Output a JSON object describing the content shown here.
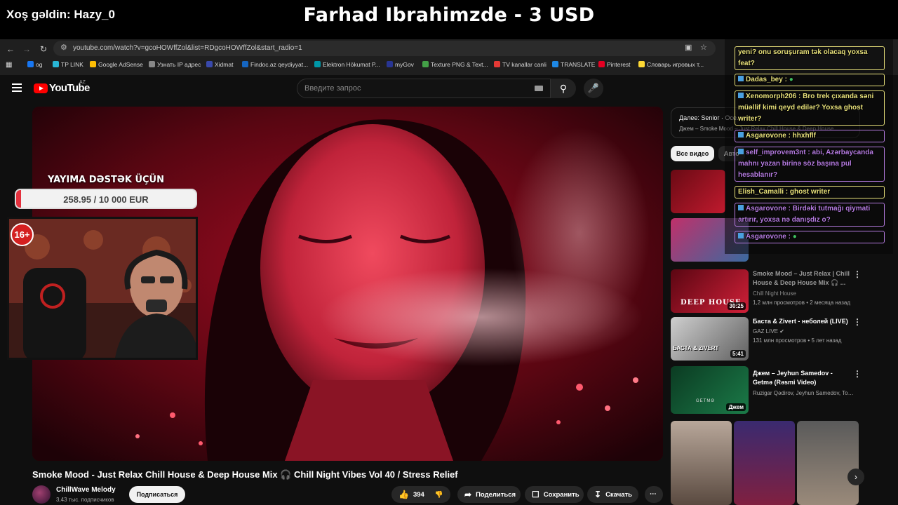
{
  "overlay": {
    "welcome": "Xoş gəldin: Hazy_0",
    "donation": "Farhad Ibrahimzde - 3 USD",
    "goal_title": "YAYIMA DƏSTƏK ÜÇÜN",
    "goal_text": "258.95 / 10 000 EUR",
    "goal_progress": 0.026,
    "age_badge": "16+",
    "chat": [
      {
        "text": "yeni? onu soruşuram tək olacaq yoxsa feat?",
        "color": "#e7e07a"
      },
      {
        "text": "Dadas_bey :",
        "color": "#e7e07a"
      },
      {
        "text": "Xenomorph206 : Bro trek çıxanda səni müəllif kimi qeyd edilər? Yoxsa ghost writer?",
        "color": "#e7e07a"
      },
      {
        "text": "Asgarovone : hhxhflf",
        "color": "#b57be0"
      },
      {
        "text": "self_improvem3nt : abi, Azərbaycanda mahnı yazan birinə söz başına pul hesablanır?",
        "color": "#b57be0"
      },
      {
        "text": "Elish_Camalli : ghost writer",
        "color": "#e7e07a"
      },
      {
        "text": "Asgarovone : Birdəki tutmağı qiymati artırır, yoxsa nə danışdız o?",
        "color": "#b57be0"
      },
      {
        "text": "Asgarovone :",
        "color": "#b57be0"
      }
    ]
  },
  "browser": {
    "url": "youtube.com/watch?v=gcoHOWffZol&list=RDgcoHOWffZol&start_radio=1",
    "bookmarks": [
      {
        "label": "og",
        "color": "#1877f2"
      },
      {
        "label": "TP LINK",
        "color": "#29b6d6"
      },
      {
        "label": "Google AdSense",
        "color": "#fbbc04"
      },
      {
        "label": "Узнать IP адрес",
        "color": "#888888"
      },
      {
        "label": "Xidmat",
        "color": "#3949ab"
      },
      {
        "label": "Findoc.az qeydiyyat...",
        "color": "#1565c0"
      },
      {
        "label": "Elektron Hökumat P...",
        "color": "#0097a7"
      },
      {
        "label": "myGov",
        "color": "#283593"
      },
      {
        "label": "Texture PNG & Text...",
        "color": "#43a047"
      },
      {
        "label": "TV kanallar canli",
        "color": "#e53935"
      },
      {
        "label": "TRANSLATE",
        "color": "#1e88e5"
      },
      {
        "label": "Pinterest",
        "color": "#e60023"
      },
      {
        "label": "Словарь игровых т...",
        "color": "#fdd835"
      }
    ]
  },
  "youtube": {
    "logo": "YouTube",
    "country": "AZ",
    "search_placeholder": "Введите запрос",
    "video_title": "Smoke Mood - Just Relax Chill House & Deep House Mix 🎧 Chill Night Vibes Vol 40 / Stress Relief",
    "channel": "ChillWave Melody",
    "subscribers": "3,43 тыс. подписчиков",
    "subscribe": "Подписаться",
    "likes": "394",
    "share": "Поделиться",
    "save": "Сохранить",
    "download": "Скачать",
    "next_line1": "Далее: Senior · Осе...",
    "next_line2": "Джем – Smoke Mood – Just Relax Chill House & Deep House",
    "chip_all": "Все видео",
    "chip_second": "Авто",
    "recommendations": [
      {
        "title": "Smoke Mood – Just Relax | Chill House & Deep House Mix 🎧 ...",
        "channel": "Chill Night House",
        "meta": "1,2 млн просмотров • 2 месяца назад",
        "duration": "30:25",
        "thumb_text": "DEEP HOUSE"
      },
      {
        "title": "Баста & Zivert - неболей (LIVE)",
        "channel": "GAZ LIVE ✔",
        "meta": "131 млн просмотров • 5 лет назад",
        "duration": "5:41",
        "thumb_text": "БАСТА & ZIVERT"
      },
      {
        "title": "Джем – Jeyhun Samedov - Getmə (Rəsmi Video)",
        "channel": "Ruzigar Qədirov, Jeyhun Samedov, Tomri...",
        "meta": "",
        "duration": "Джем",
        "thumb_text": "GETMƏ"
      }
    ]
  }
}
